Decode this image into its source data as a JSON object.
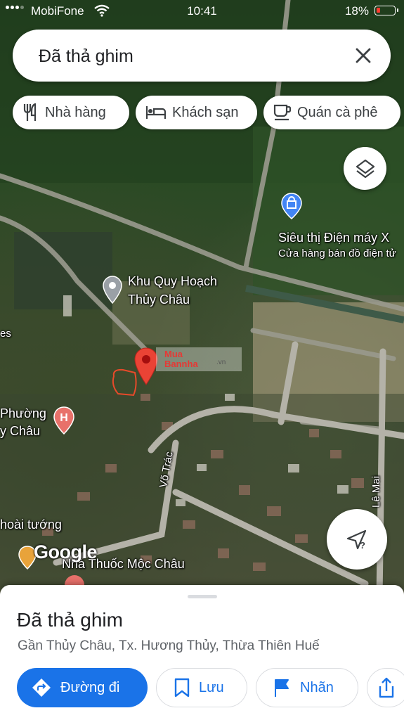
{
  "status": {
    "carrier": "MobiFone",
    "time": "10:41",
    "battery": "18%"
  },
  "search": {
    "query": "Đã thả ghim"
  },
  "chips": [
    {
      "label": "Nhà hàng",
      "icon": "restaurant-icon"
    },
    {
      "label": "Khách sạn",
      "icon": "hotel-icon"
    },
    {
      "label": "Quán cà phê",
      "icon": "cafe-icon"
    }
  ],
  "map": {
    "poi_supermarket_name": "Siêu thị Điện máy X",
    "poi_supermarket_desc": "Cửa hàng bán đồ điện tử",
    "poi_planning_line1": "Khu Quy Hoạch",
    "poi_planning_line2": "Thủy Châu",
    "ward_line1": "Phường",
    "ward_line2": "y Châu",
    "pharmacy": "Nhà Thuốc Mộc Châu",
    "street_vo_trac": "Võ Trác",
    "street_le_mai": "Lê Mai",
    "street_hoai_tuong": "hoài tướng",
    "edge_es": "es",
    "watermark_line1": "Mua",
    "watermark_line2": "Bannha",
    "watermark_suffix": ".vn",
    "google": "Google"
  },
  "sheet": {
    "title": "Đã thả ghim",
    "subtitle": "Gần Thủy Châu, Tx. Hương Thủy, Thừa Thiên Huế",
    "actions": {
      "directions": "Đường đi",
      "save": "Lưu",
      "label": "Nhãn"
    }
  },
  "colors": {
    "accent": "#1a73e8",
    "pin": "#ea4335",
    "poi_blue": "#4285f4"
  }
}
